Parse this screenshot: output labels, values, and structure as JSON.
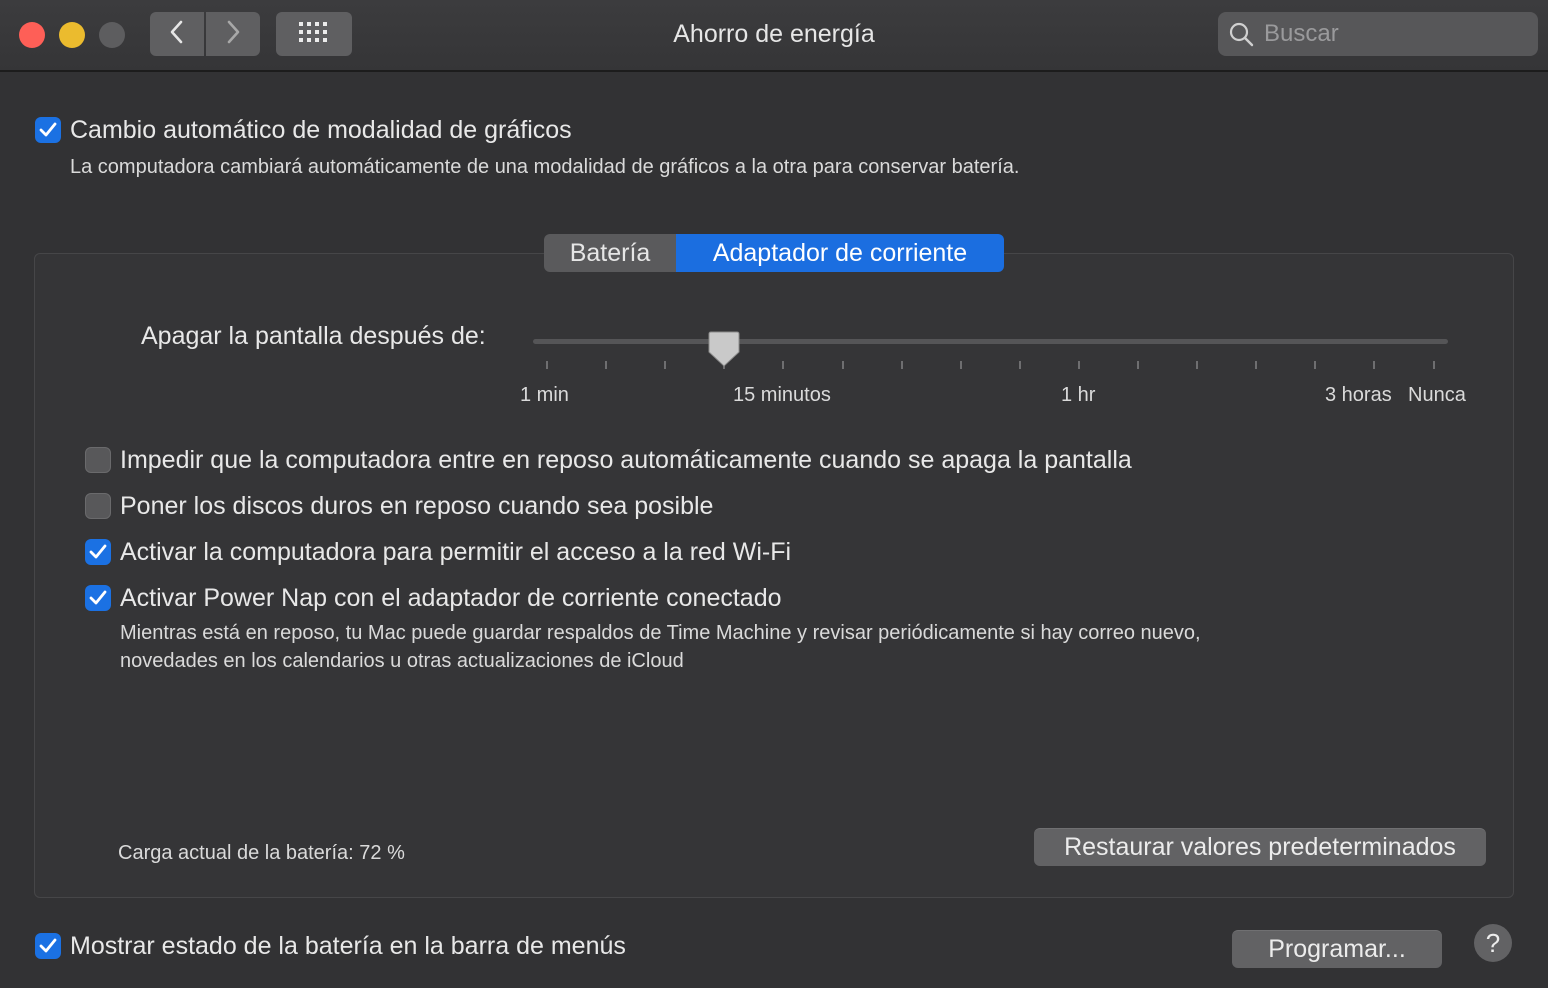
{
  "window": {
    "title": "Ahorro de energía",
    "search_placeholder": "Buscar"
  },
  "graphics_switch": {
    "label": "Cambio automático de modalidad de gráficos",
    "checked": true,
    "description": "La computadora cambiará automáticamente de una modalidad de gráficos a la otra para conservar batería."
  },
  "tabs": [
    {
      "label": "Batería",
      "selected": false
    },
    {
      "label": "Adaptador de corriente",
      "selected": true
    }
  ],
  "display_sleep": {
    "label": "Apagar la pantalla después de:",
    "value": "15 minutos",
    "tick_labels": [
      "1 min",
      "15 minutos",
      "1 hr",
      "3 horas",
      "Nunca"
    ]
  },
  "options": [
    {
      "label": "Impedir que la computadora entre en reposo automáticamente cuando se apaga la pantalla",
      "checked": false
    },
    {
      "label": "Poner los discos duros en reposo cuando sea posible",
      "checked": false
    },
    {
      "label": "Activar la computadora para permitir el acceso a la red Wi-Fi",
      "checked": true
    },
    {
      "label": "Activar Power Nap con el adaptador de corriente conectado",
      "checked": true
    }
  ],
  "power_nap_description": [
    "Mientras está en reposo, tu Mac puede guardar respaldos de Time Machine y revisar periódicamente si hay correo nuevo,",
    "novedades en los calendarios u otras actualizaciones de iCloud"
  ],
  "battery_charge_text": "Carga actual de la batería: 72 %",
  "restore_button": "Restaurar valores predeterminados",
  "menu_bar_status": {
    "label": "Mostrar estado de la batería en la barra de menús",
    "checked": true
  },
  "schedule_button": "Programar...",
  "help_button": "?",
  "colors": {
    "accent": "#1b6ee0",
    "background": "#323234"
  }
}
